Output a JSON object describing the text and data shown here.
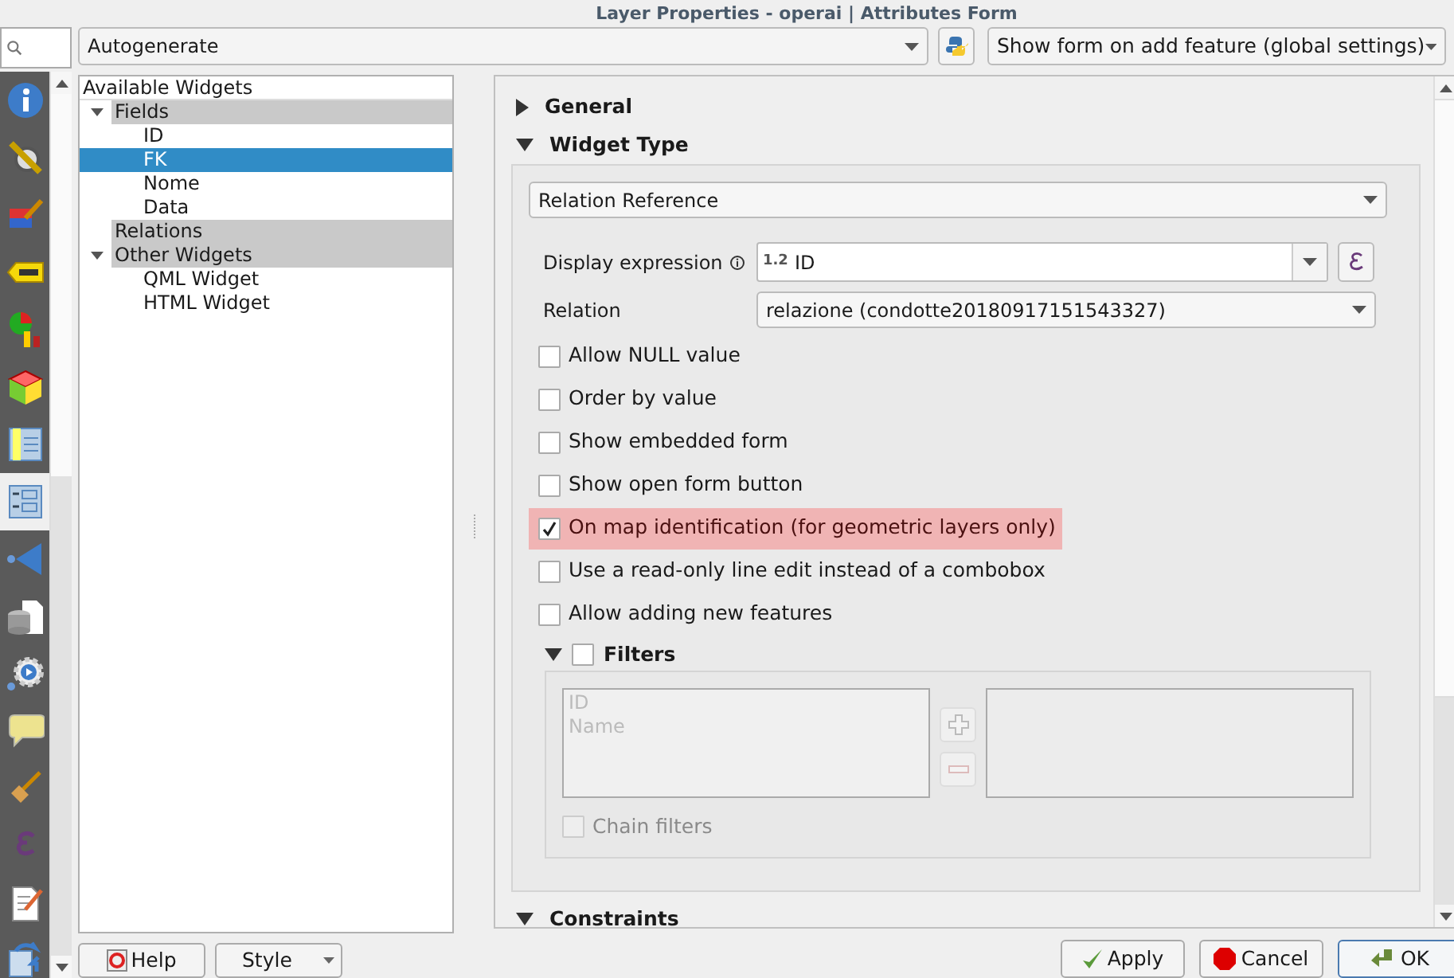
{
  "window": {
    "title": "Layer Properties - operai | Attributes Form"
  },
  "sidebar": {
    "items": [
      {
        "kind": "info",
        "selected": false
      },
      {
        "kind": "source",
        "selected": false
      },
      {
        "kind": "symbology",
        "selected": false
      },
      {
        "kind": "labels",
        "selected": false
      },
      {
        "kind": "diagrams",
        "selected": false
      },
      {
        "kind": "cube",
        "selected": false
      },
      {
        "kind": "fields",
        "selected": false
      },
      {
        "kind": "form",
        "selected": true
      },
      {
        "kind": "joins",
        "selected": false
      },
      {
        "kind": "storage",
        "selected": false
      },
      {
        "kind": "actions",
        "selected": false
      },
      {
        "kind": "display",
        "selected": false
      },
      {
        "kind": "rendering",
        "selected": false
      },
      {
        "kind": "variables",
        "selected": false
      },
      {
        "kind": "metadata",
        "selected": false
      },
      {
        "kind": "dependencies",
        "selected": false
      }
    ]
  },
  "layout_combo": {
    "value": "Autogenerate"
  },
  "suppress_combo": {
    "value": "Show form on add feature (global settings)"
  },
  "tree": {
    "header": "Available Widgets",
    "items": [
      {
        "label": "Fields",
        "kind": "group",
        "expanded": true,
        "selected": false,
        "children": [
          {
            "label": "ID",
            "kind": "field",
            "selected": false
          },
          {
            "label": "FK",
            "kind": "field",
            "selected": true
          },
          {
            "label": "Nome",
            "kind": "field",
            "selected": false
          },
          {
            "label": "Data",
            "kind": "field",
            "selected": false
          }
        ]
      },
      {
        "label": "Relations",
        "kind": "group",
        "selected": false
      },
      {
        "label": "Other Widgets",
        "kind": "group",
        "expanded": true,
        "selected": false,
        "children": [
          {
            "label": "QML Widget",
            "kind": "field",
            "selected": false
          },
          {
            "label": "HTML Widget",
            "kind": "field",
            "selected": false
          }
        ]
      }
    ]
  },
  "sections": [
    {
      "title": "General",
      "expanded": false
    },
    {
      "title": "Widget Type",
      "expanded": true
    },
    {
      "title": "Constraints",
      "expanded": true
    }
  ],
  "widget_type": {
    "value": "Relation Reference",
    "display_expression": {
      "label": "Display expression",
      "prefix": "1.2",
      "value": "ID"
    },
    "relation": {
      "label": "Relation",
      "value": "relazione (condotte20180917151543327)"
    },
    "options": [
      {
        "label": "Allow NULL value",
        "checked": false,
        "highlighted": false
      },
      {
        "label": "Order by value",
        "checked": false,
        "highlighted": false
      },
      {
        "label": "Show embedded form",
        "checked": false,
        "highlighted": false
      },
      {
        "label": "Show open form button",
        "checked": false,
        "highlighted": false
      },
      {
        "label": "On map identification (for geometric layers only)",
        "checked": true,
        "highlighted": true
      },
      {
        "label": "Use a read-only line edit instead of a combobox",
        "checked": false,
        "highlighted": false
      },
      {
        "label": "Allow adding new features",
        "checked": false,
        "highlighted": false
      }
    ],
    "filters": {
      "title": "Filters",
      "expanded": true,
      "checked": false,
      "available": [
        "ID",
        "Name"
      ],
      "chain": {
        "label": "Chain filters",
        "checked": false,
        "disabled": true
      }
    }
  },
  "buttons": {
    "help": "Help",
    "style": "Style",
    "apply": "Apply",
    "cancel": "Cancel",
    "ok": "OK"
  }
}
